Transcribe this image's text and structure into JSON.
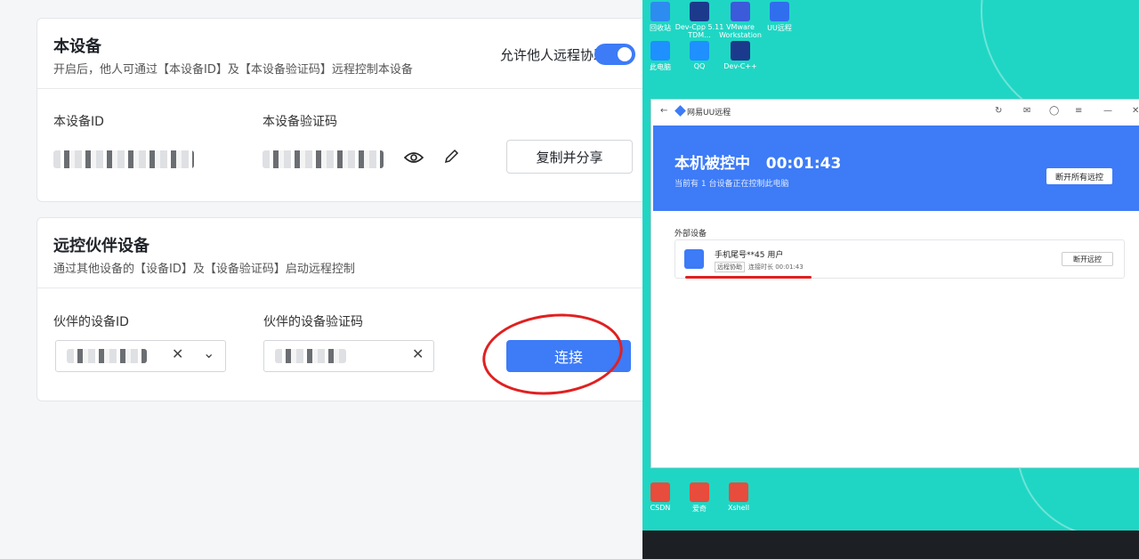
{
  "local": {
    "title": "本设备",
    "subtitle": "开启后，他人可通过【本设备ID】及【本设备验证码】远程控制本设备",
    "toggle_label": "允许他人远程协助",
    "id_label": "本设备ID",
    "code_label": "本设备验证码",
    "copy_share_label": "复制并分享"
  },
  "partner": {
    "title": "远控伙伴设备",
    "subtitle": "通过其他设备的【设备ID】及【设备验证码】启动远程控制",
    "id_label": "伙伴的设备ID",
    "code_label": "伙伴的设备验证码",
    "connect_label": "连接"
  },
  "remote_window": {
    "title": "网易UU远程",
    "status": "本机被控中",
    "timer": "00:01:43",
    "status_sub": "当前有 1 台设备正在控制此电脑",
    "disconnect_all": "断开所有远控",
    "external_label": "外部设备",
    "device_name": "手机尾号**45 用户",
    "device_tag": "远程协助",
    "device_duration": "连接时长 00:01:43",
    "disconnect": "断开远控"
  },
  "desktop_icons": [
    {
      "label": "回收站",
      "color": "#2d8cf0"
    },
    {
      "label": "Dev-Cpp 5.11 TDM...",
      "color": "#1b3a8c"
    },
    {
      "label": "VMware Workstation",
      "color": "#3b5bdb"
    },
    {
      "label": "UU远程",
      "color": "#2f6fed"
    },
    {
      "label": "此电脑",
      "color": "#1e90ff"
    },
    {
      "label": "QQ",
      "color": "#1e90ff"
    },
    {
      "label": "Dev-C++",
      "color": "#1b3a8c"
    },
    {
      "label": "CSDN",
      "color": "#e74c3c"
    },
    {
      "label": "爱奇",
      "color": "#e74c3c"
    },
    {
      "label": "Xshell",
      "color": "#e74c3c"
    }
  ]
}
